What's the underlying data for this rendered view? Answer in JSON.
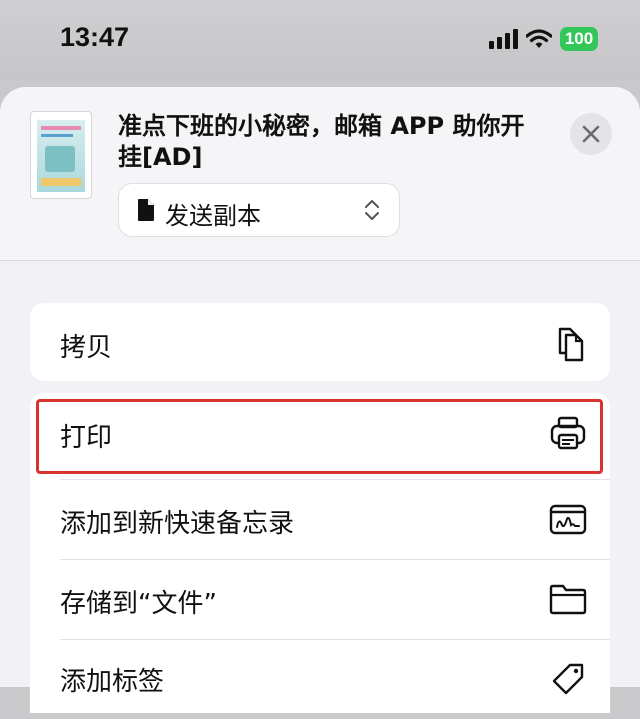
{
  "status_bar": {
    "time": "13:47",
    "battery": "100"
  },
  "share_sheet": {
    "document_title": "准点下班的小秘密，邮箱 APP 助你开挂[AD]",
    "send_option": "发送副本",
    "actions": [
      {
        "label": "拷贝",
        "icon": "copy-icon"
      },
      {
        "label": "打印",
        "icon": "printer-icon"
      },
      {
        "label": "添加到新快速备忘录",
        "icon": "quick-note-icon"
      },
      {
        "label": "存储到“文件”",
        "icon": "folder-icon"
      },
      {
        "label": "添加标签",
        "icon": "tag-icon"
      }
    ]
  },
  "colors": {
    "highlight": "#d9332f",
    "battery": "#33c759"
  }
}
